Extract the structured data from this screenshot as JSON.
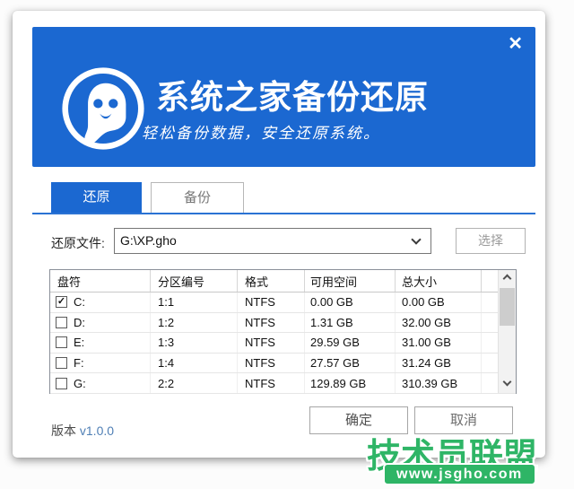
{
  "window": {
    "header": {
      "title": "系统之家备份还原",
      "subtitle": "轻松备份数据，安全还原系统。",
      "close_glyph": "✕",
      "brand_color": "#1b68d1"
    },
    "tabs": [
      {
        "label": "还原",
        "active": true
      },
      {
        "label": "备份",
        "active": false
      }
    ],
    "restore_file": {
      "label": "还原文件:",
      "value": "G:\\XP.gho",
      "choose_button": "选择"
    },
    "table": {
      "headers": [
        "盘符",
        "分区编号",
        "格式",
        "可用空间",
        "总大小"
      ],
      "rows": [
        {
          "checked": true,
          "cells": [
            "C:",
            "1:1",
            "NTFS",
            "0.00 GB",
            "0.00 GB"
          ]
        },
        {
          "checked": false,
          "cells": [
            "D:",
            "1:2",
            "NTFS",
            "1.31 GB",
            "32.00 GB"
          ]
        },
        {
          "checked": false,
          "cells": [
            "E:",
            "1:3",
            "NTFS",
            "29.59 GB",
            "31.00 GB"
          ]
        },
        {
          "checked": false,
          "cells": [
            "F:",
            "1:4",
            "NTFS",
            "27.57 GB",
            "31.24 GB"
          ]
        },
        {
          "checked": false,
          "cells": [
            "G:",
            "2:2",
            "NTFS",
            "129.89 GB",
            "310.39 GB"
          ]
        }
      ]
    },
    "footer": {
      "version_label": "版本",
      "version_value": "v1.0.0",
      "ok_button": "确定",
      "cancel_button": "取消"
    }
  },
  "icons": {
    "check_glyph": "✓"
  },
  "watermark": {
    "text": "技术员联盟",
    "url": "www.jsgho.com",
    "color": "#2eb566"
  }
}
